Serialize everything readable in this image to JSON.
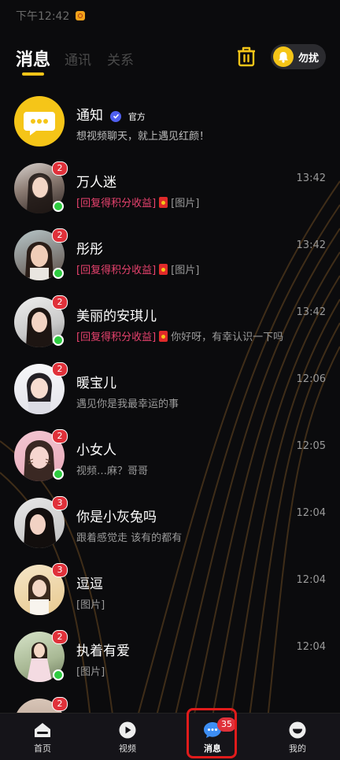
{
  "status_bar": {
    "time": "下午12:42"
  },
  "tabs": [
    {
      "label": "消息",
      "active": true
    },
    {
      "label": "通讯",
      "active": false
    },
    {
      "label": "关系",
      "active": false
    }
  ],
  "dnd": {
    "label": "勿扰"
  },
  "notification": {
    "name": "通知",
    "tag": "官方",
    "preview": "想视频聊天，就上遇见红颜！"
  },
  "conversations": [
    {
      "name": "万人迷",
      "time": "13:42",
      "badge": "2",
      "online": true,
      "promo": "[回复得积分收益]",
      "preview": "[图片]"
    },
    {
      "name": "彤彤",
      "time": "13:42",
      "badge": "2",
      "online": true,
      "promo": "[回复得积分收益]",
      "preview": "[图片]"
    },
    {
      "name": "美丽的安琪儿",
      "time": "13:42",
      "badge": "2",
      "online": true,
      "promo": "[回复得积分收益]",
      "preview": "你好呀，有幸认识一下吗"
    },
    {
      "name": "暖宝儿",
      "time": "12:06",
      "badge": "2",
      "online": false,
      "promo": "",
      "preview": "遇见你是我最幸运的事"
    },
    {
      "name": "小女人",
      "time": "12:05",
      "badge": "2",
      "online": true,
      "promo": "",
      "preview": "视频…麻？哥哥"
    },
    {
      "name": "你是小灰兔吗",
      "time": "12:04",
      "badge": "3",
      "online": false,
      "promo": "",
      "preview": "跟着感觉走 该有的都有"
    },
    {
      "name": "逗逗",
      "time": "12:04",
      "badge": "3",
      "online": false,
      "promo": "",
      "preview": "[图片]"
    },
    {
      "name": "执着有爱",
      "time": "12:04",
      "badge": "2",
      "online": true,
      "promo": "",
      "preview": "[图片]"
    }
  ],
  "bottom_nav": [
    {
      "label": "首页",
      "icon": "home-icon"
    },
    {
      "label": "视频",
      "icon": "video-play-icon"
    },
    {
      "label": "消息",
      "icon": "message-icon",
      "badge": "35"
    },
    {
      "label": "我的",
      "icon": "profile-icon"
    }
  ],
  "colors": {
    "accent": "#f5c518",
    "badge": "#e0313a",
    "online": "#2ecc40",
    "promo": "#e8426e"
  }
}
